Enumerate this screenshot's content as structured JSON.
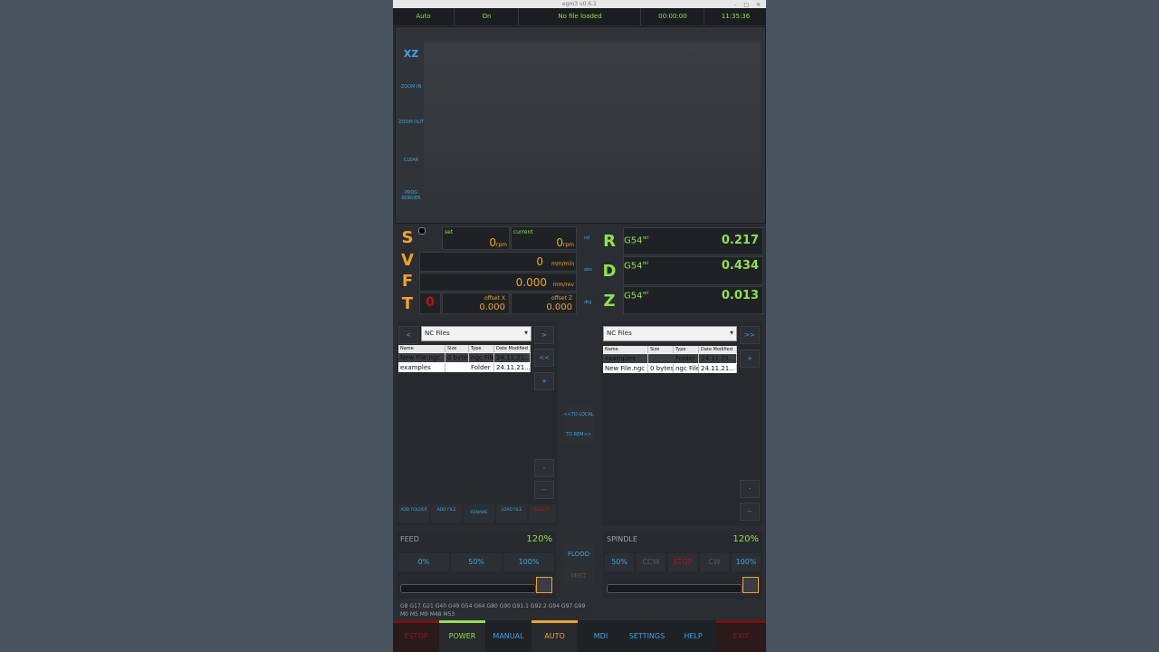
{
  "window": {
    "title": "egm3 v0.6.1"
  },
  "status": {
    "mode": "Auto",
    "power": "On",
    "file": "No file loaded",
    "run_time": "00:00:00",
    "clock": "11:35:36"
  },
  "preview": {
    "view": "XZ",
    "buttons": [
      "ZOOM IN",
      "ZOOM OUT",
      "CLEAR",
      "PROG BORDER"
    ]
  },
  "spindle_panel": {
    "s_letter": "S",
    "v_letter": "V",
    "f_letter": "F",
    "t_letter": "T",
    "set_label": "set",
    "current_label": "current",
    "set_value": "0",
    "current_value": "0",
    "rpm_unit": "rpm",
    "v_value": "0",
    "v_unit": "mm/min",
    "f_value": "0.000",
    "f_unit": "mm/rev",
    "tool": "0",
    "offset_x_label": "offset X",
    "offset_x_value": "0.000",
    "offset_z_label": "offset Z",
    "offset_z_value": "0.000"
  },
  "dro": {
    "modes": [
      "rel",
      "abs",
      "dtg"
    ],
    "axes": [
      {
        "letter": "R",
        "wcs": "G54",
        "sup": "rel",
        "value": "0.217"
      },
      {
        "letter": "D",
        "wcs": "G54",
        "sup": "rel",
        "value": "0.434"
      },
      {
        "letter": "Z",
        "wcs": "G54",
        "sup": "rel",
        "value": "0.013"
      }
    ]
  },
  "file_manager": {
    "local": {
      "folder": "NC Files",
      "headers": [
        "Name",
        "Size",
        "Type",
        "Date Modified"
      ],
      "rows": [
        {
          "name": "New File.ngc",
          "size": "0 bytes",
          "type": "ngc File",
          "date": "24.11.21..."
        },
        {
          "name": "examples",
          "size": "",
          "type": "Folder",
          "date": "24.11.21..."
        }
      ],
      "buttons": [
        "ADD FOLDER",
        "ADD FILE",
        "RENAME",
        "LOAD FILE",
        "DELETE"
      ],
      "nav": [
        "<",
        ">",
        "<<",
        "+",
        "-",
        "--"
      ]
    },
    "remote": {
      "folder": "NC Files",
      "headers": [
        "Name",
        "Size",
        "Type",
        "Date Modified"
      ],
      "rows": [
        {
          "name": "examples",
          "size": "",
          "type": "Folder",
          "date": "24.11.21..."
        },
        {
          "name": "New File.ngc",
          "size": "0 bytes",
          "type": "ngc File",
          "date": "24.11.21..."
        }
      ],
      "nav": [
        ">>",
        "+",
        "-",
        "--"
      ]
    },
    "to_local": "<<TO LOCAL",
    "to_remote": "TO REM>>"
  },
  "feed": {
    "title": "FEED",
    "percent": "120%",
    "buttons": [
      "0%",
      "50%",
      "100%"
    ]
  },
  "spindle_ov": {
    "title": "SPINDLE",
    "percent": "120%",
    "buttons": [
      "50%",
      "CCW",
      "STOP",
      "CW",
      "100%"
    ]
  },
  "coolant": {
    "flood": "FLOOD",
    "mist": "MIST"
  },
  "gcodes": {
    "line1": "G8 G17 G21 G40 G49 G54 G64 G80 G90 G91.1 G92.2 G94 G97 G99",
    "line2": "M0 M5 M9 M48 M53"
  },
  "tabs": [
    "ESTOP",
    "POWER",
    "MANUAL",
    "AUTO",
    "MDI",
    "SETTINGS",
    "HELP",
    "EXIT"
  ],
  "colors": {
    "green": "#8ee34a",
    "orange": "#f0a32a",
    "blue": "#3ca3e6",
    "red": "#c01010"
  }
}
